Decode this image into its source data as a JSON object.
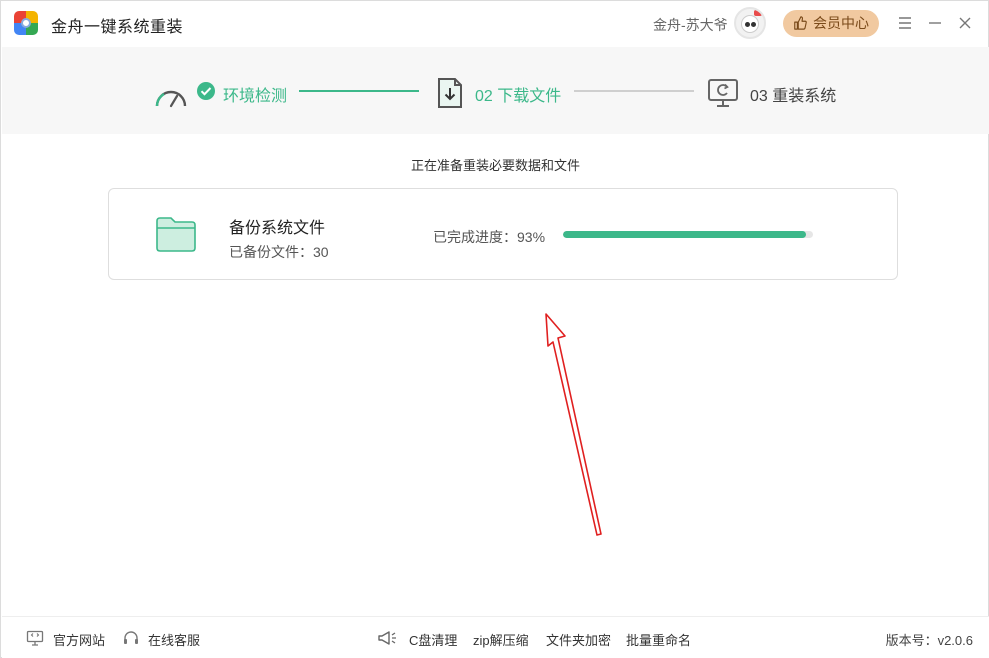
{
  "app": {
    "title": "金舟一键系统重装",
    "user_name": "金舟-苏大爷",
    "vip_label": "会员中心"
  },
  "steps": [
    {
      "label": "环境检测",
      "state": "done"
    },
    {
      "label": "02 下载文件",
      "state": "active"
    },
    {
      "label": "03 重装系统",
      "state": "pending"
    }
  ],
  "main": {
    "subtitle": "正在准备重装必要数据和文件",
    "card": {
      "title": "备份系统文件",
      "sub_label": "已备份文件：30",
      "progress_label": "已完成进度：93%",
      "progress": 0.97
    }
  },
  "footer": {
    "official_site": "官方网站",
    "online_service": "在线客服",
    "c_clean": "C盘清理",
    "zip": "zip解压缩",
    "folder_encrypt": "文件夹加密",
    "batch_rename": "批量重命名",
    "version": "版本号：v2.0.6"
  },
  "colors": {
    "accent": "#3cb88a",
    "vip_bg": "#f1c9a0",
    "annotation": "#e02020"
  },
  "icons": [
    "app-logo-icon",
    "menu-icon",
    "minimize-icon",
    "close-icon",
    "gauge-icon",
    "check-icon",
    "download-file-icon",
    "monitor-refresh-icon",
    "folder-icon",
    "thumbs-up-icon",
    "monitor-link-icon",
    "headset-icon",
    "megaphone-icon"
  ]
}
